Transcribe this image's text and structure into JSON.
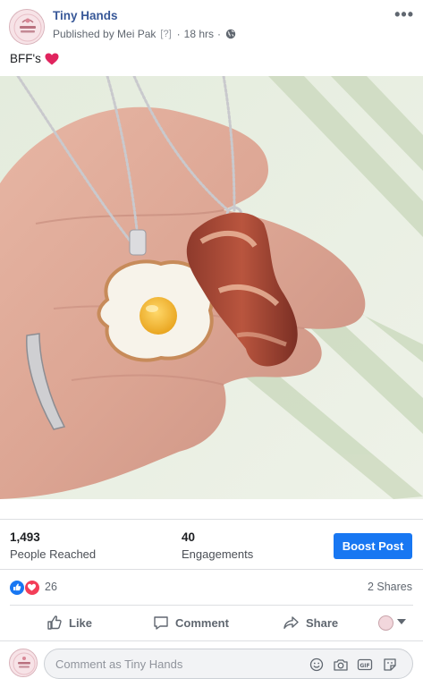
{
  "post": {
    "page_name": "Tiny Hands",
    "avatar_text": "TINY HANDS",
    "published_by": "Published by Mei Pak",
    "help_marker": "[?]",
    "separator": "·",
    "time": "18 hrs",
    "privacy_icon": "globe-icon",
    "more_icon": "more-options-icon",
    "more_label": "•••",
    "caption": "BFF's",
    "caption_emoji": "red-heart-icon",
    "photo_subject": "egg and bacon charm necklaces on a hand"
  },
  "stats": {
    "reached_value": "1,493",
    "reached_label": "People Reached",
    "engagements_value": "40",
    "engagements_label": "Engagements",
    "boost_label": "Boost Post"
  },
  "reactions": {
    "types": [
      "like-reaction-icon",
      "love-reaction-icon"
    ],
    "count": "26",
    "shares": "2 Shares"
  },
  "actions": {
    "like": "Like",
    "comment": "Comment",
    "share": "Share",
    "audience_icon": "page-avatar-selector"
  },
  "composer": {
    "placeholder": "Comment as Tiny Hands",
    "icons": [
      "emoji-icon",
      "camera-icon",
      "gif-icon",
      "sticker-icon"
    ]
  },
  "colors": {
    "brand_blue": "#1877f2",
    "link_blue": "#385898",
    "love_red": "#f33e58",
    "muted_text": "#606770"
  }
}
